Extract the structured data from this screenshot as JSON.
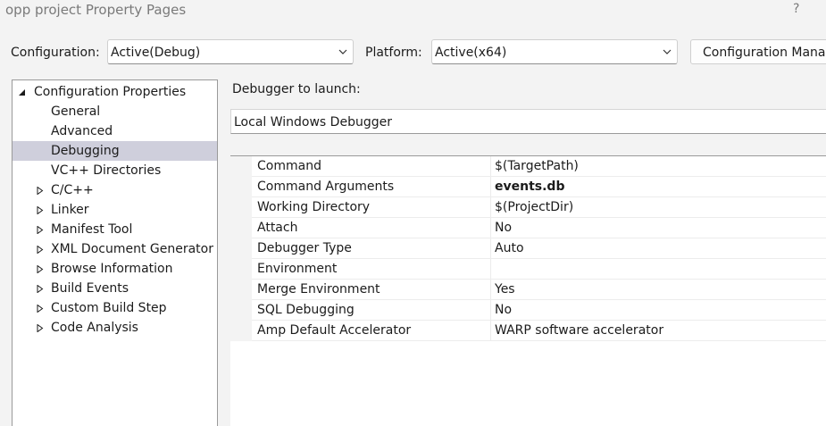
{
  "window": {
    "title": "opp project Property Pages",
    "help_label": "?"
  },
  "toolbar": {
    "configuration_label": "Configuration:",
    "configuration_value": "Active(Debug)",
    "platform_label": "Platform:",
    "platform_value": "Active(x64)",
    "config_manager_label": "Configuration Manager..."
  },
  "tree": {
    "items": [
      {
        "label": "Configuration Properties",
        "level": 0,
        "expander": "expanded"
      },
      {
        "label": "General",
        "level": 1,
        "expander": "none"
      },
      {
        "label": "Advanced",
        "level": 1,
        "expander": "none"
      },
      {
        "label": "Debugging",
        "level": 1,
        "expander": "none",
        "selected": true
      },
      {
        "label": "VC++ Directories",
        "level": 1,
        "expander": "none"
      },
      {
        "label": "C/C++",
        "level": 1,
        "expander": "collapsed"
      },
      {
        "label": "Linker",
        "level": 1,
        "expander": "collapsed"
      },
      {
        "label": "Manifest Tool",
        "level": 1,
        "expander": "collapsed"
      },
      {
        "label": "XML Document Generator",
        "level": 1,
        "expander": "collapsed"
      },
      {
        "label": "Browse Information",
        "level": 1,
        "expander": "collapsed"
      },
      {
        "label": "Build Events",
        "level": 1,
        "expander": "collapsed"
      },
      {
        "label": "Custom Build Step",
        "level": 1,
        "expander": "collapsed"
      },
      {
        "label": "Code Analysis",
        "level": 1,
        "expander": "collapsed"
      }
    ]
  },
  "debugger": {
    "launch_label": "Debugger to launch:",
    "launch_value": "Local Windows Debugger"
  },
  "properties": [
    {
      "name": "Command",
      "value": "$(TargetPath)",
      "bold": false
    },
    {
      "name": "Command Arguments",
      "value": "events.db",
      "bold": true
    },
    {
      "name": "Working Directory",
      "value": "$(ProjectDir)",
      "bold": false
    },
    {
      "name": "Attach",
      "value": "No",
      "bold": false
    },
    {
      "name": "Debugger Type",
      "value": "Auto",
      "bold": false
    },
    {
      "name": "Environment",
      "value": "",
      "bold": false
    },
    {
      "name": "Merge Environment",
      "value": "Yes",
      "bold": false
    },
    {
      "name": "SQL Debugging",
      "value": "No",
      "bold": false
    },
    {
      "name": "Amp Default Accelerator",
      "value": "WARP software accelerator",
      "bold": false
    }
  ],
  "colors": {
    "selection": "#cfcfdc",
    "window_bg": "#f3f3f3",
    "panel_bg": "#ffffff"
  },
  "icons": {
    "expanded": "triangle-down-right-icon",
    "collapsed": "triangle-right-icon",
    "dropdown": "chevron-down-icon"
  }
}
